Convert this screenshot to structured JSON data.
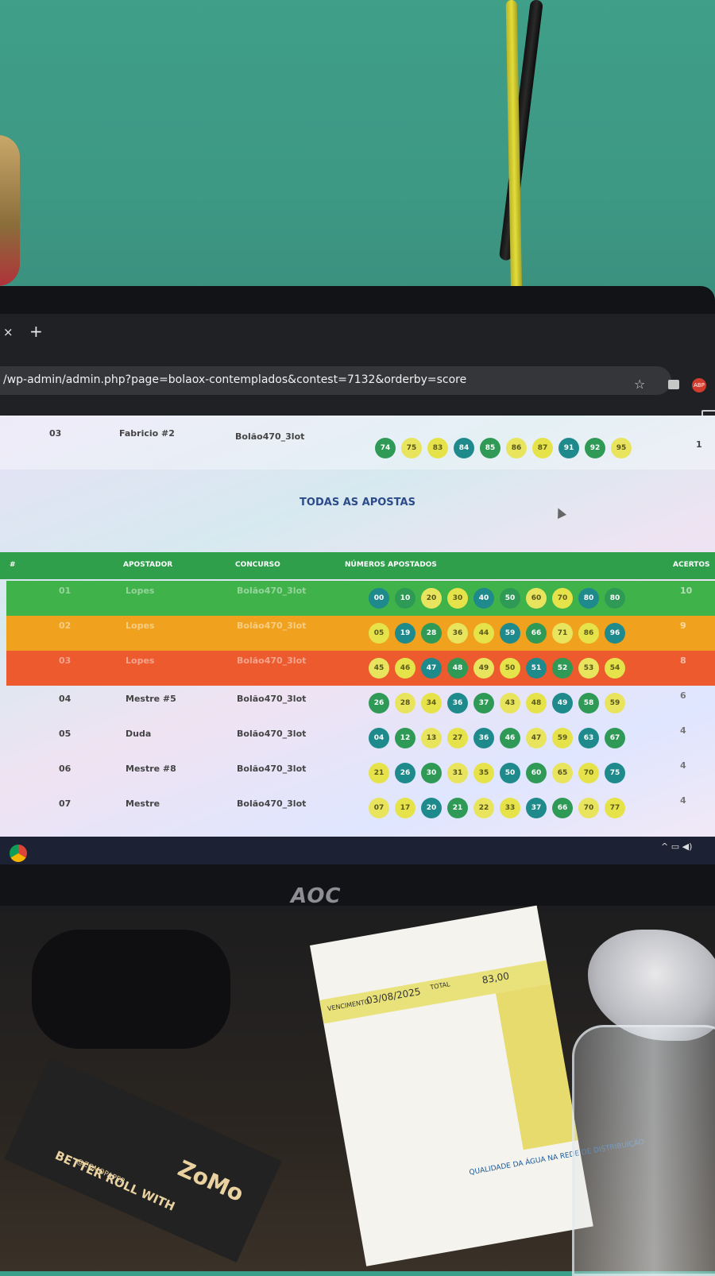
{
  "browser": {
    "url": "/wp-admin/admin.php?page=bolaox-contemplados&contest=7132&orderby=score",
    "new_tab": "+",
    "close_tab": "×",
    "extension_badge": "ABP"
  },
  "top_row": {
    "num": "03",
    "apostador": "Fabricio #2",
    "concurso": "Bolão470_3lot",
    "numbers": [
      "74",
      "75",
      "83",
      "84",
      "85",
      "86",
      "87",
      "91",
      "92",
      "95"
    ],
    "acertos": "1"
  },
  "section_title": "TODAS AS APOSTAS",
  "table": {
    "headers": [
      "#",
      "APOSTADOR",
      "CONCURSO",
      "NÚMEROS APOSTADOS",
      "ACERTOS"
    ],
    "rows": [
      {
        "num": "01",
        "apostador": "Lopes",
        "concurso": "Bolão470_3lot",
        "numbers": [
          "00",
          "10",
          "20",
          "30",
          "40",
          "50",
          "60",
          "70",
          "80",
          "80"
        ],
        "acertos": "10"
      },
      {
        "num": "02",
        "apostador": "Lopes",
        "concurso": "Bolão470_3lot",
        "numbers": [
          "05",
          "19",
          "28",
          "36",
          "44",
          "59",
          "66",
          "71",
          "86",
          "96"
        ],
        "acertos": "9"
      },
      {
        "num": "03",
        "apostador": "Lopes",
        "concurso": "Bolão470_3lot",
        "numbers": [
          "45",
          "46",
          "47",
          "48",
          "49",
          "50",
          "51",
          "52",
          "53",
          "54"
        ],
        "acertos": "8"
      },
      {
        "num": "04",
        "apostador": "Mestre #5",
        "concurso": "Bolão470_3lot",
        "numbers": [
          "26",
          "28",
          "34",
          "36",
          "37",
          "43",
          "48",
          "49",
          "58",
          "59"
        ],
        "acertos": "6"
      },
      {
        "num": "05",
        "apostador": "Duda",
        "concurso": "Bolão470_3lot",
        "numbers": [
          "04",
          "12",
          "13",
          "27",
          "36",
          "46",
          "47",
          "59",
          "63",
          "67"
        ],
        "acertos": "4"
      },
      {
        "num": "06",
        "apostador": "Mestre #8",
        "concurso": "Bolão470_3lot",
        "numbers": [
          "21",
          "26",
          "30",
          "31",
          "35",
          "50",
          "60",
          "65",
          "70",
          "75"
        ],
        "acertos": "4"
      },
      {
        "num": "07",
        "apostador": "Mestre",
        "concurso": "Bolão470_3lot",
        "numbers": [
          "07",
          "17",
          "20",
          "21",
          "22",
          "33",
          "37",
          "66",
          "70",
          "77"
        ],
        "acertos": "4"
      }
    ]
  },
  "colors": {
    "row_green": "#3fb24a",
    "row_orange": "#f0a21e",
    "row_red": "#ec5a2e",
    "header_green": "#2f9f4b"
  },
  "monitor_brand": "AOC",
  "desk": {
    "zomo_slogan": "BETTER ROLL WITH",
    "zomo_logo": "ZoMo",
    "zomo_handle": "@ZOMOPAPER",
    "receipt_due_label": "VENCIMENTO",
    "receipt_due_date": "03/08/2025",
    "receipt_total_label": "TOTAL",
    "receipt_total": "83,00",
    "receipt_footer": "QUALIDADE DA ÁGUA NA REDE DE DISTRIBUIÇÃO"
  }
}
